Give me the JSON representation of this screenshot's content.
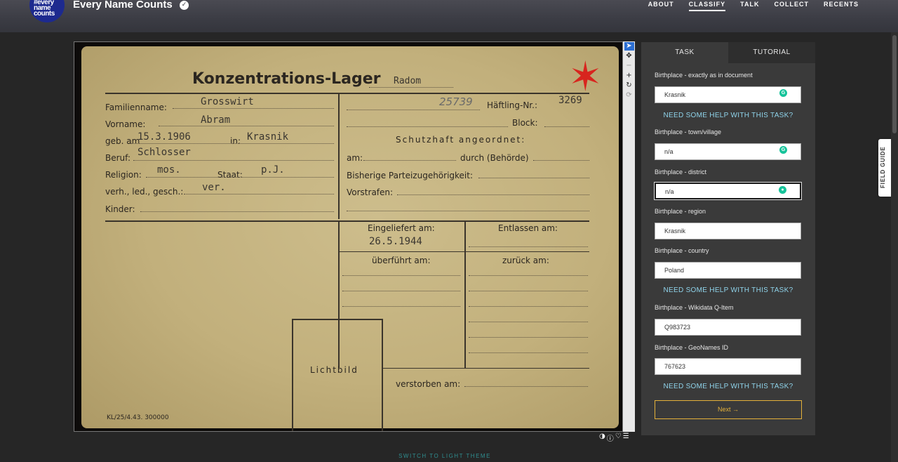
{
  "header": {
    "logo_text": "#every name counts",
    "title": "Every Name Counts",
    "nav": [
      "ABOUT",
      "CLASSIFY",
      "TALK",
      "COLLECT",
      "RECENTS"
    ],
    "active_nav": "CLASSIFY"
  },
  "card": {
    "heading": "Konzentrations-Lager",
    "camp": "Radom",
    "labels": {
      "familienname": "Familienname:",
      "vorname": "Vorname:",
      "geb_am": "geb. am",
      "in": "in:",
      "beruf": "Beruf:",
      "religion": "Religion:",
      "staat": "Staat:",
      "verh": "verh., led., gesch.:",
      "kinder": "Kinder:",
      "haeftling_nr": "Häftling-Nr.:",
      "block": "Block:",
      "schutzhaft": "Schutzhaft angeordnet:",
      "am": "am:",
      "durch": "durch (Behörde)",
      "partei": "Bisherige Parteizugehörigkeit:",
      "vorstrafen": "Vorstrafen:",
      "eingeliefert": "Eingeliefert am:",
      "entlassen": "Entlassen am:",
      "ueberfuehrt": "überführt am:",
      "zurueck": "zurück am:",
      "lichtbild": "Lichtbild",
      "verstorben": "verstorben am:",
      "form_code": "KL/25/4.43. 300000"
    },
    "typed": {
      "familienname": "Grosswirt",
      "vorname": "Abram",
      "geb_am": "15.3.1906",
      "in": "Krasnik",
      "beruf": "Schlosser",
      "religion": "mos.",
      "staat": "p.J.",
      "verh": "ver.",
      "handwritten_nr": "25739",
      "haeftling_nr": "3269",
      "eingeliefert": "26.5.1944"
    }
  },
  "panel": {
    "tabs": [
      "TASK",
      "TUTORIAL"
    ],
    "fields": [
      {
        "label": "Birthplace - exactly as in document",
        "value": "Krasnik"
      },
      {
        "label": "Birthplace - town/village",
        "value": "n/a"
      },
      {
        "label": "Birthplace - district",
        "value": "n/a"
      },
      {
        "label": "Birthplace - region",
        "value": "Krasnik"
      },
      {
        "label": "Birthplace - country",
        "value": "Poland"
      },
      {
        "label": "Birthplace - Wikidata Q-Item",
        "value": "Q983723"
      },
      {
        "label": "Birthplace - GeoNames ID",
        "value": "767623"
      }
    ],
    "help_text": "NEED SOME HELP WITH THIS TASK?",
    "next_label": "Next →"
  },
  "field_guide": "FIELD GUIDE",
  "theme_link": "SWITCH TO LIGHT THEME",
  "colors": {
    "accent_next": "#e4b13a",
    "help_link": "#8fd3ea",
    "logo_blue": "#1d2a8f",
    "star_red": "#d8251e"
  }
}
